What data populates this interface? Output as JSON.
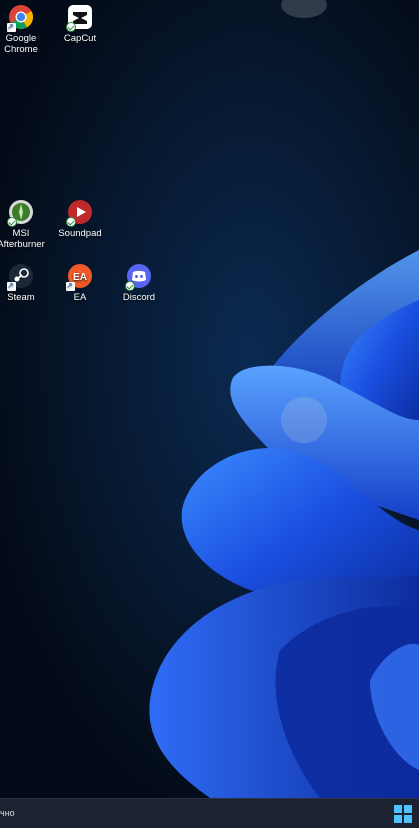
{
  "desktop": {
    "icons": [
      {
        "label": "Google\nChrome",
        "icon": "chrome-icon"
      },
      {
        "label": "CapCut",
        "icon": "capcut-icon"
      },
      {
        "label": "MSI\nAfterburner",
        "icon": "msi-afterburner-icon"
      },
      {
        "label": "Soundpad",
        "icon": "soundpad-icon"
      },
      {
        "label": "Steam",
        "icon": "steam-icon"
      },
      {
        "label": "EA",
        "icon": "ea-icon"
      },
      {
        "label": "Discord",
        "icon": "discord-icon"
      }
    ]
  },
  "taskbar": {
    "status_text": "чно"
  },
  "colors": {
    "wallpaper_bg": "#06101f",
    "bloom_blue": "#1e5cff",
    "taskbar_bg": "#1c2230",
    "start_accent": "#4cc2ff"
  }
}
